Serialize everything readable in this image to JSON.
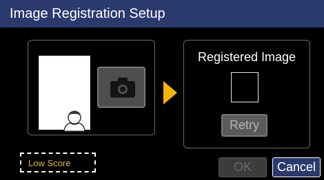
{
  "header": {
    "title": "Image Registration Setup"
  },
  "capture_panel": {
    "face_icon": "person-silhouette-icon",
    "camera_icon": "camera-icon"
  },
  "arrow_icon": "arrow-right-icon",
  "registered_panel": {
    "label": "Registered Image",
    "retry_label": "Retry"
  },
  "status": {
    "low_score_label": "Low Score"
  },
  "footer": {
    "ok_label": "OK",
    "cancel_label": "Cancel"
  },
  "colors": {
    "header_bg": "#2a3a6e",
    "accent_arrow": "#f4b400",
    "warning_text": "#e6b838"
  }
}
